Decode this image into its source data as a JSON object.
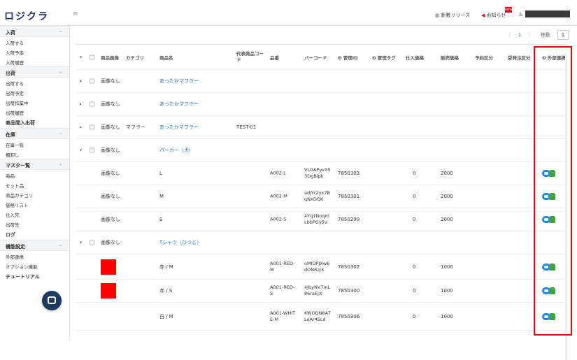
{
  "header": {
    "logo": "ロジクラ",
    "menu_icon": "menu-icon",
    "release_label": "新着リリース",
    "notice_label": "お知らせ",
    "notice_badge": "new"
  },
  "sidebar": {
    "sections": [
      {
        "label": "入荷",
        "items": [
          "入荷する",
          "入荷予定",
          "入荷履歴"
        ]
      },
      {
        "label": "出荷",
        "items": [
          "出荷する",
          "出荷予定",
          "出荷作業中",
          "出荷履歴"
        ]
      },
      {
        "label": "商品間入出荷",
        "items": [],
        "plain": true
      },
      {
        "label": "在庫",
        "items": [
          "在庫一覧",
          "棚卸し"
        ]
      },
      {
        "label": "マスター覧",
        "items": [
          "商品",
          "セット品",
          "商品カテゴリ",
          "価格リスト",
          "仕入先",
          "出荷先"
        ]
      },
      {
        "label": "ログ",
        "items": [],
        "plain": true
      },
      {
        "label": "機能設定",
        "items": [
          "外部連携",
          "オプション機能"
        ]
      },
      {
        "label": "チュートリアル",
        "items": [],
        "plain": true
      }
    ]
  },
  "pager": {
    "prev": "〈",
    "current": "1",
    "next": "〉",
    "move_label": "移動",
    "page_input": "1"
  },
  "table": {
    "headers": {
      "image": "商品画像",
      "category": "カテゴリ",
      "name": "商品名",
      "code": "代表商品コード",
      "sku": "品番",
      "barcode": "バーコード",
      "mgmt_id": "❷ 管理ID",
      "mgmt_tag": "❷ 管理タグ",
      "cost": "仕入価格",
      "price": "販売価格",
      "reserve": "予約区分",
      "order": "受発注区分",
      "external": "❷ 外部連携"
    },
    "rows": [
      {
        "type": "parent",
        "expanded": false,
        "image": "画像なし",
        "category": "",
        "name": "あったかマフラー",
        "code": ""
      },
      {
        "type": "parent",
        "expanded": false,
        "image": "画像なし",
        "category": "",
        "name": "あったかマフラー",
        "code": ""
      },
      {
        "type": "parent",
        "expanded": false,
        "image": "画像なし",
        "category": "マフラー",
        "name": "あったかマフラー",
        "code": "TEST-01"
      },
      {
        "type": "parent",
        "expanded": true,
        "image": "画像なし",
        "category": "",
        "name": "パーカー（犬）",
        "code": ""
      },
      {
        "type": "child",
        "image": "画像なし",
        "name": "L",
        "sku": "A002-L",
        "barcode": "VLDAPyvX5\n3DgBlpk",
        "mgmt_id": "7850303",
        "cost": "0",
        "price": "2000",
        "external": true
      },
      {
        "type": "child",
        "image": "画像なし",
        "name": "M",
        "sku": "A002-M",
        "barcode": "adjYr2yx7B\nqNxDQK",
        "mgmt_id": "7850301",
        "cost": "0",
        "price": "2000",
        "external": true
      },
      {
        "type": "child",
        "image": "画像なし",
        "name": "S",
        "sku": "A002-S",
        "barcode": "4Yq1Noqm\nLbbPGy5V",
        "mgmt_id": "7850299",
        "cost": "0",
        "price": "2000",
        "external": true
      },
      {
        "type": "parent",
        "expanded": true,
        "image": "画像なし",
        "category": "",
        "name": "Tシャツ（ひつじ）",
        "code": ""
      },
      {
        "type": "child",
        "image": "swatch",
        "name": "赤 / M",
        "sku": "A001-RED-\nM",
        "barcode": "oMIDPJXw6\ndONRzJ3",
        "mgmt_id": "7850302",
        "cost": "0",
        "price": "1000",
        "external": true
      },
      {
        "type": "child",
        "image": "swatch",
        "name": "赤 / S",
        "sku": "A001-RED-\nS",
        "barcode": "4JbyNV7mL\n86raEJX",
        "mgmt_id": "7850300",
        "cost": "0",
        "price": "1000",
        "external": true
      },
      {
        "type": "child",
        "image": "",
        "name": "白 / M",
        "sku": "A001-WHIT\nE-M",
        "barcode": "KWODN8A7\nLeAr45Ld",
        "mgmt_id": "7850306",
        "cost": "0",
        "price": "1000",
        "external": true
      }
    ]
  },
  "colors": {
    "accent": "#1a73c8",
    "highlight": "#e60000",
    "swatch": "#ff0000",
    "sidebar_section": "#f4f5f7"
  }
}
